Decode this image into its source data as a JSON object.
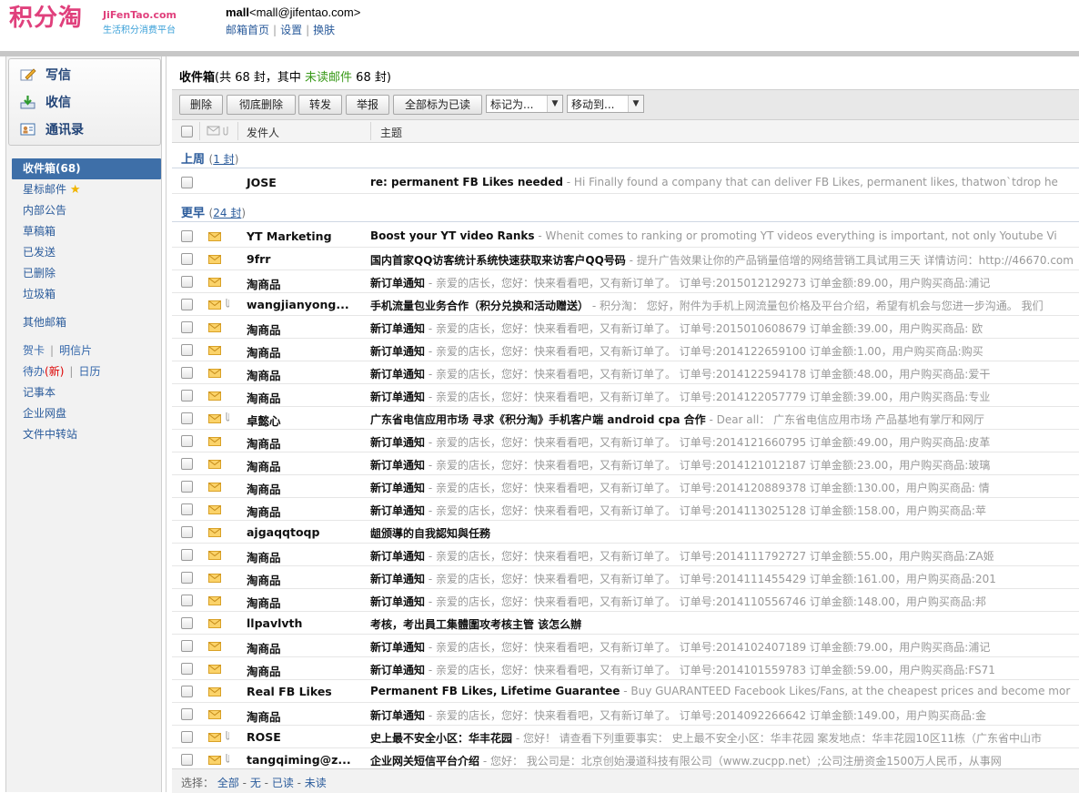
{
  "brand": {
    "logo_cn": "积分淘",
    "logo_en": "JiFenTao.com",
    "tagline": "生活积分消费平台",
    "color": "#e0407c"
  },
  "user": {
    "name": "mall",
    "email": "<mall@jifentao.com>"
  },
  "toplinks": [
    "邮箱首页",
    "设置",
    "换肤"
  ],
  "compose": {
    "write": "写信",
    "receive": "收信",
    "contacts": "通讯录"
  },
  "sidebar": {
    "folders": [
      "收件箱(68)",
      "星标邮件",
      "内部公告",
      "草稿箱",
      "已发送",
      "已删除",
      "垃圾箱"
    ],
    "other": "其他邮箱",
    "tools": {
      "card": "贺卡",
      "postcard": "明信片",
      "todo": "待办",
      "todo_new": "(新)",
      "calendar": "日历",
      "notes": "记事本",
      "disk": "企业网盘",
      "transfer": "文件中转站"
    }
  },
  "inbox": {
    "title": "收件箱",
    "summary_prefix": "(共 68 封，其中 ",
    "unread_label": "未读邮件",
    "summary_suffix": " 68 封)"
  },
  "toolbar": {
    "delete": "删除",
    "perm_delete": "彻底删除",
    "forward": "转发",
    "report": "举报",
    "mark_all_read": "全部标为已读",
    "mark_as": "标记为...",
    "move_to": "移动到..."
  },
  "columns": {
    "sender": "发件人",
    "subject": "主题"
  },
  "groups": [
    {
      "label": "上周",
      "count_open": "(",
      "count": "1 封",
      "count_close": ")"
    },
    {
      "label": "更早",
      "count_open": "(",
      "count": "24 封",
      "count_close": ")"
    }
  ],
  "emails_lastweek": [
    {
      "from": "JOSE",
      "subject": "re: permanent FB Likes needed",
      "preview": " - Hi Finally found a company that can deliver FB Likes, permanent likes, thatwon`tdrop  he",
      "clip": false
    }
  ],
  "emails_earlier": [
    {
      "from": "YT Marketing",
      "subject": "Boost your YT video Ranks",
      "preview": " - Whenit comes to ranking or promoting YT videos everything  is important, not only Youtube Vi",
      "clip": false
    },
    {
      "from": "9frr",
      "subject": "国内首家QQ访客统计系统快速获取来访客户QQ号码",
      "preview": " - 提升广告效果让你的产品销量倍增的网络营销工具试用三天 详情访问：http://46670.com",
      "clip": false
    },
    {
      "from": "淘商品",
      "subject": "新订单通知",
      "preview": " - 亲爱的店长，您好：快来看看吧，又有新订单了。 订单号:2015012129273 订单金额:89.00，用户购买商品:浦记",
      "clip": false
    },
    {
      "from": "wangjianyong...",
      "subject": "手机流量包业务合作（积分兑换和活动赠送）",
      "preview": " - 积分淘：      您好，附件为手机上网流量包价格及平台介绍，希望有机会与您进一步沟通。      我们",
      "clip": true
    },
    {
      "from": "淘商品",
      "subject": "新订单通知",
      "preview": " - 亲爱的店长，您好：快来看看吧，又有新订单了。 订单号:2015010608679 订单金额:39.00，用户购买商品: 欧",
      "clip": false
    },
    {
      "from": "淘商品",
      "subject": "新订单通知",
      "preview": " - 亲爱的店长，您好：快来看看吧，又有新订单了。 订单号:2014122659100 订单金额:1.00，用户购买商品:购买",
      "clip": false
    },
    {
      "from": "淘商品",
      "subject": "新订单通知",
      "preview": " - 亲爱的店长，您好：快来看看吧，又有新订单了。 订单号:2014122594178 订单金额:48.00，用户购买商品:爱干",
      "clip": false
    },
    {
      "from": "淘商品",
      "subject": "新订单通知",
      "preview": " - 亲爱的店长，您好：快来看看吧，又有新订单了。 订单号:2014122057779 订单金额:39.00，用户购买商品:专业",
      "clip": false
    },
    {
      "from": "卓懿心",
      "subject": "广东省电信应用市场 寻求《积分淘》手机客户端 android cpa 合作",
      "preview": " - Dear all：               广东省电信应用市场 产品基地有掌厅和网厅",
      "clip": true
    },
    {
      "from": "淘商品",
      "subject": "新订单通知",
      "preview": " - 亲爱的店长，您好：快来看看吧，又有新订单了。 订单号:2014121660795 订单金额:49.00，用户购买商品:皮革",
      "clip": false
    },
    {
      "from": "淘商品",
      "subject": "新订单通知",
      "preview": " - 亲爱的店长，您好：快来看看吧，又有新订单了。 订单号:2014121012187 订单金额:23.00，用户购买商品:玻璃",
      "clip": false
    },
    {
      "from": "淘商品",
      "subject": "新订单通知",
      "preview": " - 亲爱的店长，您好：快来看看吧，又有新订单了。 订单号:2014120889378 订单金额:130.00，用户购买商品: 情",
      "clip": false
    },
    {
      "from": "淘商品",
      "subject": "新订单通知",
      "preview": " - 亲爱的店长，您好：快来看看吧，又有新订单了。 订单号:2014113025128 订单金额:158.00，用户购买商品:苹",
      "clip": false
    },
    {
      "from": "ajgaqqtoqp",
      "subject": "龃颁導的自我認知與任務",
      "preview": "",
      "clip": false
    },
    {
      "from": "淘商品",
      "subject": "新订单通知",
      "preview": " - 亲爱的店长，您好：快来看看吧，又有新订单了。 订单号:2014111792727 订单金额:55.00，用户购买商品:ZA姬",
      "clip": false
    },
    {
      "from": "淘商品",
      "subject": "新订单通知",
      "preview": " - 亲爱的店长，您好：快来看看吧，又有新订单了。 订单号:2014111455429 订单金额:161.00，用户购买商品:201",
      "clip": false
    },
    {
      "from": "淘商品",
      "subject": "新订单通知",
      "preview": " - 亲爱的店长，您好：快来看看吧，又有新订单了。 订单号:2014110556746 订单金额:148.00，用户购买商品:邦",
      "clip": false
    },
    {
      "from": "llpavlvth",
      "subject": "考核，考出員工集體圍攻考核主管 该怎么辦",
      "preview": "",
      "clip": false
    },
    {
      "from": "淘商品",
      "subject": "新订单通知",
      "preview": " - 亲爱的店长，您好：快来看看吧，又有新订单了。 订单号:2014102407189 订单金额:79.00，用户购买商品:浦记",
      "clip": false
    },
    {
      "from": "淘商品",
      "subject": "新订单通知",
      "preview": " - 亲爱的店长，您好：快来看看吧，又有新订单了。 订单号:2014101559783 订单金额:59.00，用户购买商品:FS71",
      "clip": false
    },
    {
      "from": "Real FB Likes",
      "subject": "Permanent FB Likes, Lifetime Guarantee",
      "preview": " - Buy GUARANTEED Facebook Likes/Fans, at the cheapest prices and become mor",
      "clip": false
    },
    {
      "from": "淘商品",
      "subject": "新订单通知",
      "preview": " - 亲爱的店长，您好：快来看看吧，又有新订单了。 订单号:2014092266642 订单金额:149.00，用户购买商品:金",
      "clip": false
    },
    {
      "from": "ROSE",
      "subject": "史上最不安全小区：华丰花园",
      "preview": " - 您好！ 请查看下列重要事实：  史上最不安全小区：华丰花园   案发地点：华丰花园10区11栋（广东省中山市",
      "clip": true
    },
    {
      "from": "tangqiming@z...",
      "subject": "企业网关短信平台介绍",
      "preview": " - 您好：       我公司是：北京创始漫道科技有限公司（www.zucpp.net）;公司注册资金1500万人民币，从事网",
      "clip": true
    }
  ],
  "footer": {
    "select_label": "选择：",
    "all": "全部",
    "none": "无",
    "read": "已读",
    "unread": "未读"
  }
}
